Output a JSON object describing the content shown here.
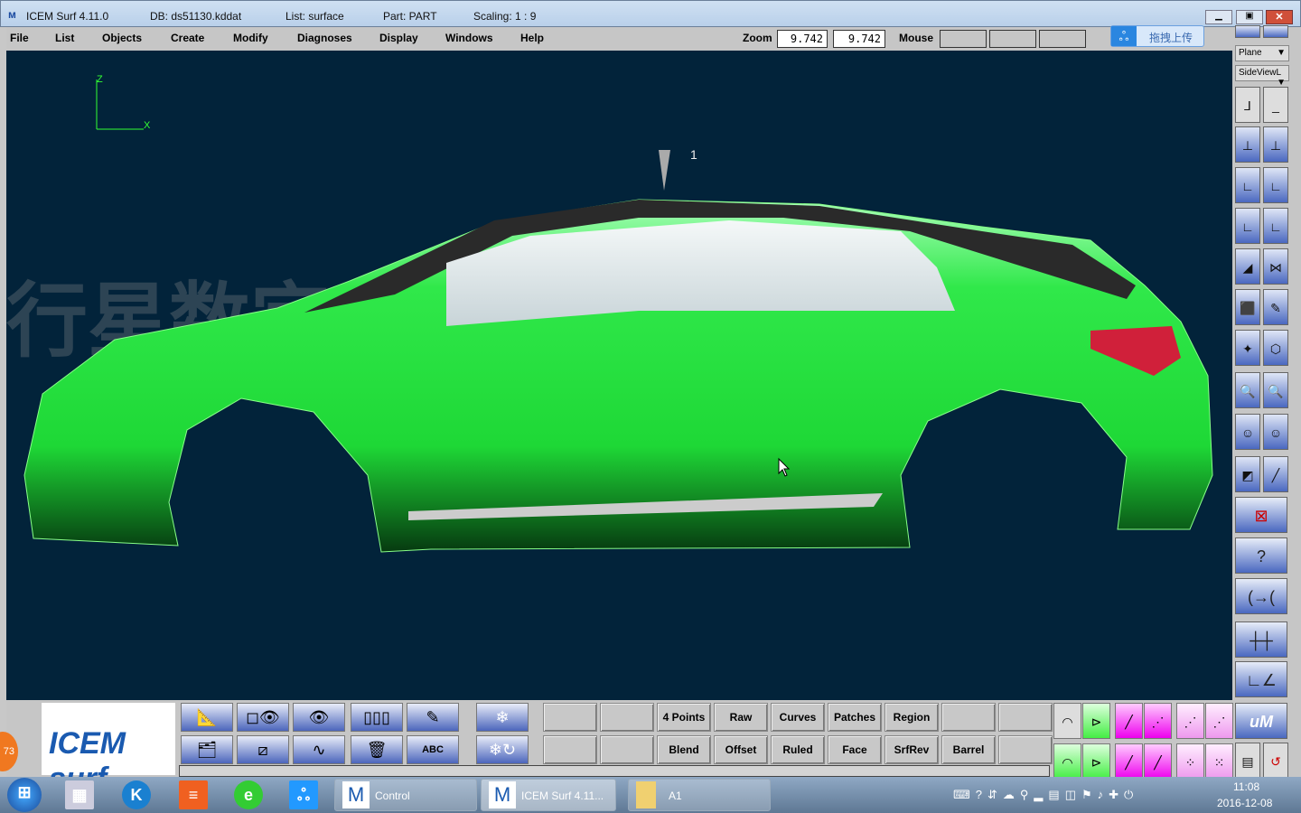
{
  "title": {
    "app": "ICEM Surf 4.11.0",
    "db": "DB: ds51130.kddat",
    "list": "List: surface",
    "part": "Part: PART",
    "scaling": "Scaling: 1 : 9"
  },
  "menu": [
    "File",
    "List",
    "Objects",
    "Create",
    "Modify",
    "Diagnoses",
    "Display",
    "Windows",
    "Help"
  ],
  "zoom": {
    "label": "Zoom",
    "value1": "9.742",
    "value2": "9.742"
  },
  "mouse": {
    "label": "Mouse"
  },
  "upload": {
    "label": "拖拽上传"
  },
  "window_controls": [
    "minimize",
    "maximize",
    "close"
  ],
  "right_panel": {
    "plane_select": "Plane",
    "view_select": "SideViewL"
  },
  "viewport": {
    "axis_z": "Z",
    "axis_x": "X",
    "marker_label": "1",
    "watermark": "行星数字工业",
    "colors": {
      "background": "#02233a",
      "surface": "#22e03a"
    }
  },
  "bottom": {
    "logo_text": "ICEM surf",
    "row1": [
      "4 Points",
      "Raw",
      "Curves",
      "Patches",
      "Region"
    ],
    "row2": [
      "Blend",
      "Offset",
      "Ruled",
      "Face",
      "SrfRev",
      "Barrel"
    ],
    "icon_row1": [
      "axis-plane-icon",
      "view-eye-box-icon",
      "eye-icon",
      "move-objects-icon",
      "pencil-folder-icon",
      "freeze-icon"
    ],
    "icon_row2": [
      "folders-icon",
      "section-plane-icon",
      "curve-probe-icon",
      "trash-icon",
      "label-abc-icon",
      "unfreeze-icon"
    ]
  },
  "badge": "73",
  "taskbar": {
    "tasks": [
      "Control",
      "ICEM Surf 4.11...",
      "A1"
    ],
    "time": "11:08",
    "date": "2016-12-08"
  }
}
